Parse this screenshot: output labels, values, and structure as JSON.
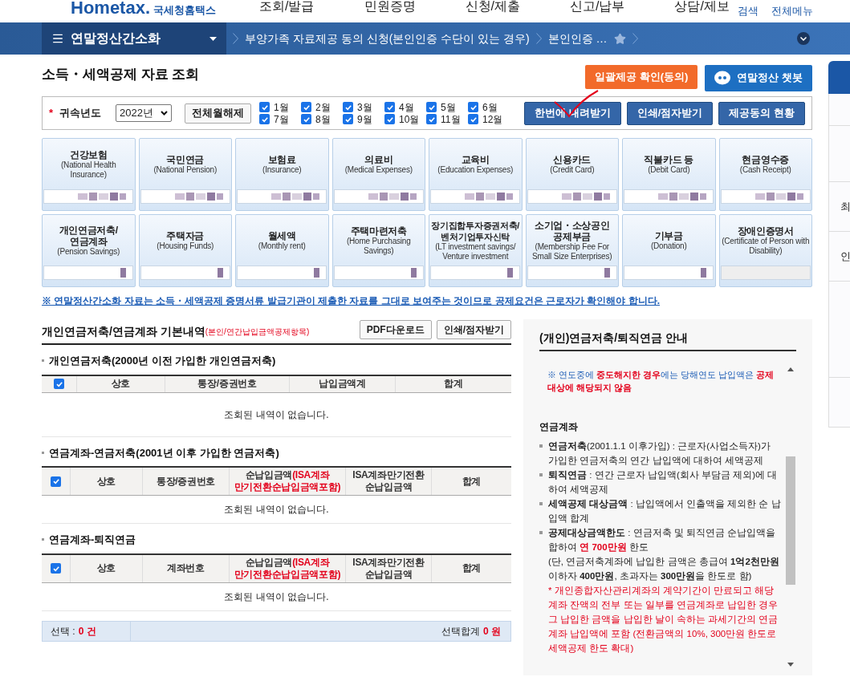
{
  "header": {
    "logo": "Hometax.",
    "logo_sub": "국세청홈택스",
    "menu": [
      "조회/발급",
      "민원증명",
      "신청/제출",
      "신고/납부",
      "상담/제보"
    ],
    "links": [
      "검색",
      "전체메뉴"
    ]
  },
  "breadcrumb": {
    "menu_title": "연말정산간소화",
    "items": [
      "부양가족 자료제공 동의 신청(본인인증 수단이 있는 경우)",
      "본인인증 …"
    ]
  },
  "page_title": "소득・세액공제 자료 조회",
  "top_buttons": [
    {
      "label": "일괄제공 확인(동의)",
      "kind": "consent"
    },
    {
      "label": "연말정산 챗봇",
      "kind": "chatbot"
    }
  ],
  "filter": {
    "required_mark": "*",
    "label": "귀속년도",
    "year": "2022년",
    "clear_button": "전체월해제",
    "months": [
      {
        "label": "1월",
        "checked": true
      },
      {
        "label": "2월",
        "checked": true
      },
      {
        "label": "3월",
        "checked": true
      },
      {
        "label": "4월",
        "checked": true
      },
      {
        "label": "5월",
        "checked": true
      },
      {
        "label": "6월",
        "checked": true
      },
      {
        "label": "7월",
        "checked": true
      },
      {
        "label": "8월",
        "checked": true
      },
      {
        "label": "9월",
        "checked": true
      },
      {
        "label": "10월",
        "checked": true
      },
      {
        "label": "11월",
        "checked": true
      },
      {
        "label": "12월",
        "checked": true
      }
    ],
    "actions": [
      "한번에 내려받기",
      "인쇄/점자받기",
      "제공동의 현황"
    ]
  },
  "categories": [
    {
      "title": "건강보험",
      "subtitle": "(National Health\nInsurance)",
      "disabled": false
    },
    {
      "title": "국민연금",
      "subtitle": "(National Pension)",
      "disabled": false
    },
    {
      "title": "보험료",
      "subtitle": "(Insurance)",
      "disabled": false
    },
    {
      "title": "의료비",
      "subtitle": "(Medical Expenses)",
      "disabled": false
    },
    {
      "title": "교육비",
      "subtitle": "(Education Expenses)",
      "disabled": false
    },
    {
      "title": "신용카드",
      "subtitle": "(Credit Card)",
      "disabled": false
    },
    {
      "title": "직불카드 등",
      "subtitle": "(Debit Card)",
      "disabled": false
    },
    {
      "title": "현금영수증",
      "subtitle": "(Cash Receipt)",
      "disabled": false
    },
    {
      "title": "개인연금저축/\n연금계좌",
      "subtitle": "(Pension Savings)",
      "disabled": false
    },
    {
      "title": "주택자금",
      "subtitle": "(Housing Funds)",
      "disabled": false
    },
    {
      "title": "월세액",
      "subtitle": "(Monthly rent)",
      "disabled": false
    },
    {
      "title": "주택마련저축",
      "subtitle": "(Home Purchasing\nSavings)",
      "disabled": false
    },
    {
      "title": "장기집합투자증권저축/\n벤처기업투자신탁",
      "subtitle": "(LT investment savings/\nVenture investment",
      "disabled": false
    },
    {
      "title": "소기업・소상공인\n공제부금",
      "subtitle": "(Membership Fee For\nSmall Size Enterprises)",
      "disabled": false
    },
    {
      "title": "기부금",
      "subtitle": "(Donation)",
      "disabled": false
    },
    {
      "title": "장애인증명서",
      "subtitle": "(Certificate of Person with\nDisability)",
      "disabled": true
    }
  ],
  "notice": "※ 연말정산간소화 자료는 소득・세액공제 증명서류 발급기관이 제출한 자료를 그대로 보여주는 것이므로 공제요건은 근로자가 확인해야 합니다.",
  "section": {
    "title": "개인연금저축/연금계좌 기본내역",
    "title_note": "(본인/연간납입금액공제항목)",
    "buttons": [
      "PDF다운로드",
      "인쇄/점자받기"
    ],
    "tables": [
      {
        "title": "개인연금저축(2000년 이전 가입한 개인연금저축)",
        "select_all": true,
        "columns": [
          [
            {
              "text": "상호",
              "kind": "normal"
            }
          ],
          [
            {
              "text": "통장/증권번호",
              "kind": "normal"
            }
          ],
          [
            {
              "text": "납입금액계",
              "kind": "normal"
            }
          ],
          [
            {
              "text": "합계",
              "kind": "normal"
            }
          ]
        ],
        "empty": "조회된 내역이 없습니다."
      },
      {
        "title": "연금계좌-연금저축(2001년 이후 가입한 연금저축)",
        "select_all": true,
        "columns": [
          [
            {
              "text": "상호",
              "kind": "normal"
            }
          ],
          [
            {
              "text": "통장/증권번호",
              "kind": "normal"
            }
          ],
          [
            {
              "text": "순납입금액",
              "kind": "normal"
            },
            {
              "text": "(ISA계좌\n만기전환순납입금액포함)",
              "kind": "warning"
            }
          ],
          [
            {
              "text": "ISA계좌만기전환\n순납입금액",
              "kind": "normal"
            }
          ],
          [
            {
              "text": "합계",
              "kind": "normal"
            }
          ]
        ],
        "empty": "조회된 내역이 없습니다."
      },
      {
        "title": "연금계좌-퇴직연금",
        "select_all": true,
        "columns": [
          [
            {
              "text": "상호",
              "kind": "normal"
            }
          ],
          [
            {
              "text": "계좌번호",
              "kind": "normal"
            }
          ],
          [
            {
              "text": "순납입금액",
              "kind": "normal"
            },
            {
              "text": "(ISA계좌\n만기전환순납입금액포함)",
              "kind": "warning"
            }
          ],
          [
            {
              "text": "ISA계좌만기전환\n순납입금액",
              "kind": "normal"
            }
          ],
          [
            {
              "text": "합계",
              "kind": "normal"
            }
          ]
        ],
        "empty": "조회된 내역이 없습니다."
      }
    ],
    "summary": {
      "selected_label": "선택 :",
      "selected_count": "0 건",
      "total_label": "선택합계",
      "total_value": "0 원"
    }
  },
  "guide": {
    "title": "(개인)연금저축/퇴직연금 안내",
    "paragraphs": [
      {
        "kind": "note",
        "lines": [
          [
            {
              "text": "※ 연도중에 ",
              "kind": "info"
            },
            {
              "text": "중도해지한 경우",
              "kind": "warning"
            },
            {
              "text": "에는 당해연도 납입액은 ",
              "kind": "info"
            },
            {
              "text": "공제대상에 해당되지 않음",
              "kind": "warning"
            }
          ]
        ]
      },
      {
        "kind": "heading",
        "text": "연금계좌"
      },
      {
        "kind": "bullet",
        "lines": [
          [
            {
              "text": "연금저축",
              "kind": "strong"
            },
            {
              "text": "(2001.1.1 이후가입) : 근로자(사업소득자)가 가입한 연금저축의 연간 납입액에 대하여 세액공제",
              "kind": "normal"
            }
          ]
        ]
      },
      {
        "kind": "bullet",
        "lines": [
          [
            {
              "text": "퇴직연금",
              "kind": "strong"
            },
            {
              "text": " : 연간 근로자 납입액(회사 부담금 제외)에 대하여 세액공제",
              "kind": "normal"
            }
          ]
        ]
      },
      {
        "kind": "bullet",
        "lines": [
          [
            {
              "text": "세액공제 대상금액",
              "kind": "strong"
            },
            {
              "text": " : 납입액에서 인출액을 제외한 순 납입액 합계",
              "kind": "normal"
            }
          ]
        ]
      },
      {
        "kind": "bullet",
        "lines": [
          [
            {
              "text": "공제대상금액한도",
              "kind": "strong"
            },
            {
              "text": " : 연금저축 및 퇴직연금 순납입액을 합하여 ",
              "kind": "normal"
            },
            {
              "text": "연 700만원",
              "kind": "warning"
            },
            {
              "text": " 한도",
              "kind": "normal"
            }
          ],
          [
            {
              "text": "(단, 연금저축계좌에 납입한 금액은 총급여 ",
              "kind": "normal"
            },
            {
              "text": "1억2천만원",
              "kind": "strong"
            },
            {
              "text": " 이하자 ",
              "kind": "normal"
            },
            {
              "text": "400만원",
              "kind": "strong"
            },
            {
              "text": ", 초과자는 ",
              "kind": "normal"
            },
            {
              "text": "300만원",
              "kind": "strong"
            },
            {
              "text": "을 한도로 함)",
              "kind": "normal"
            }
          ],
          [
            {
              "text": "* 개인종합자산관리계좌의 계약기간이 만료되고 해당 계좌 잔액의 전부 또는 일부를 연금계좌로 납입한 경우 그 납입한 금액을 납입한 날이 속하는 과세기간의 연금계좌 납입액에 포함 (전환금액의 10%, 300만원 한도로 세액공제 한도 확대)",
              "kind": "caution"
            }
          ]
        ]
      }
    ]
  },
  "side_panel": {
    "items": [
      "최",
      "인"
    ]
  }
}
